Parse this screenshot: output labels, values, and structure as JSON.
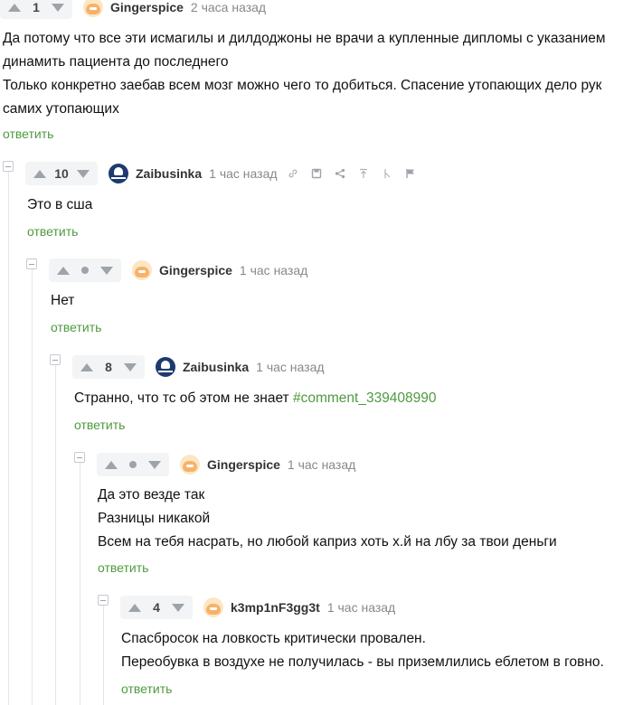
{
  "comments": [
    {
      "votes": "1",
      "author": "Gingerspice",
      "time": "2 часа назад",
      "lines": [
        "Да потому что все эти исмагилы и дилдоджоны не врачи а купленные дипломы с указанием",
        "динамить пациента до последнего",
        "Только конкретно заебав всем мозг можно чего то добиться. Спасение утопающих дело рук",
        "самих утопающих"
      ],
      "reply": "ответить"
    },
    {
      "votes": "10",
      "author": "Zaibusinka",
      "time": "1 час назад",
      "lines": [
        "Это в сша"
      ],
      "reply": "ответить",
      "tools": [
        "link-icon",
        "save-icon",
        "share-icon",
        "arrow-up-icon",
        "branch-icon",
        "flag-icon"
      ]
    },
    {
      "votes": "",
      "author": "Gingerspice",
      "time": "1 час назад",
      "lines": [
        "Нет"
      ],
      "reply": "ответить"
    },
    {
      "votes": "8",
      "author": "Zaibusinka",
      "time": "1 час назад",
      "line_prefix": "Странно, что тс об этом не знает ",
      "line_link": "#comment_339408990",
      "reply": "ответить"
    },
    {
      "votes": "",
      "author": "Gingerspice",
      "time": "1 час назад",
      "lines": [
        "Да это везде так",
        "Разницы никакой",
        "Всем на тебя насрать, но любой каприз хоть х.й на лбу за твои деньги"
      ],
      "reply": "ответить"
    },
    {
      "votes": "4",
      "author": "k3mp1nF3gg3t",
      "time": "1 час назад",
      "lines": [
        "Спасбросок на ловкость критически провален.",
        "Переобувка в воздухе не получилась - вы приземлились еблетом в говно."
      ],
      "reply": "ответить"
    }
  ],
  "colors": {
    "link": "#4e9a3f",
    "vote_icon": "#9ea3aa",
    "author": "#333333",
    "time": "#888888"
  }
}
